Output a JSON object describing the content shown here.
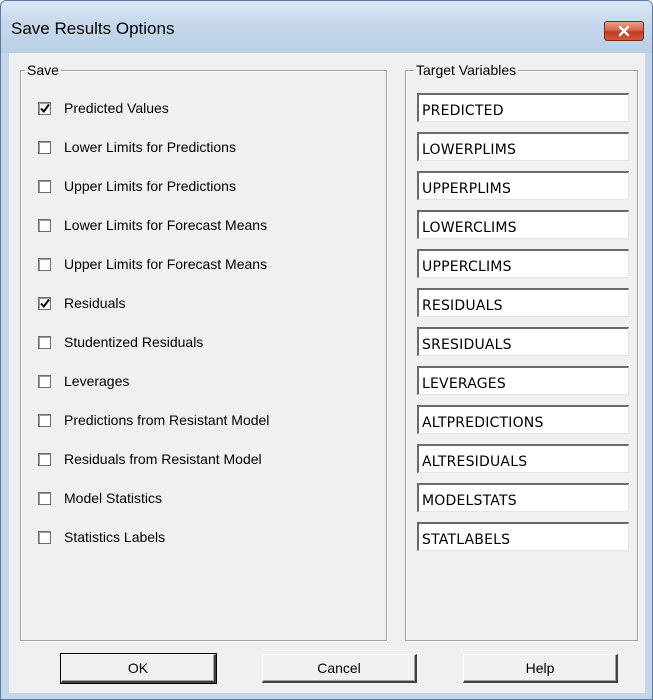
{
  "window": {
    "title": "Save Results Options"
  },
  "save_group": {
    "label": "Save",
    "options": [
      {
        "label": "Predicted Values",
        "checked": true
      },
      {
        "label": "Lower Limits for Predictions",
        "checked": false
      },
      {
        "label": "Upper Limits for Predictions",
        "checked": false
      },
      {
        "label": "Lower Limits for Forecast Means",
        "checked": false
      },
      {
        "label": "Upper Limits for Forecast Means",
        "checked": false
      },
      {
        "label": "Residuals",
        "checked": true
      },
      {
        "label": "Studentized Residuals",
        "checked": false
      },
      {
        "label": "Leverages",
        "checked": false
      },
      {
        "label": "Predictions from Resistant Model",
        "checked": false
      },
      {
        "label": "Residuals from Resistant Model",
        "checked": false
      },
      {
        "label": "Model Statistics",
        "checked": false
      },
      {
        "label": "Statistics Labels",
        "checked": false
      }
    ]
  },
  "target_group": {
    "label": "Target Variables",
    "fields": [
      "PREDICTED",
      "LOWERPLIMS",
      "UPPERPLIMS",
      "LOWERCLIMS",
      "UPPERCLIMS",
      "RESIDUALS",
      "SRESIDUALS",
      "LEVERAGES",
      "ALTPREDICTIONS",
      "ALTRESIDUALS",
      "MODELSTATS",
      "STATLABELS"
    ]
  },
  "buttons": {
    "ok": "OK",
    "cancel": "Cancel",
    "help": "Help"
  }
}
